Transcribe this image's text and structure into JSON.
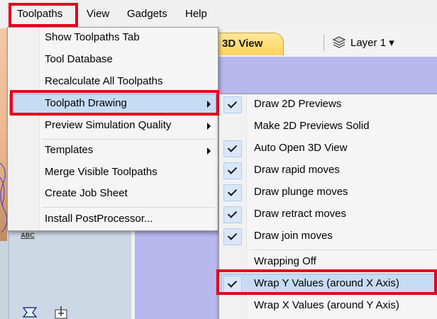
{
  "menubar": {
    "items": [
      {
        "label": "Toolpaths"
      },
      {
        "label": "View"
      },
      {
        "label": "Gadgets"
      },
      {
        "label": "Help"
      }
    ]
  },
  "view_tab": {
    "label": "3D View"
  },
  "toolbar": {
    "layer_label": "Layer 1 ▾"
  },
  "toolpaths_menu": {
    "items": [
      {
        "label": "Show Toolpaths Tab"
      },
      {
        "label": "Tool Database"
      },
      {
        "label": "Recalculate All Toolpaths"
      },
      {
        "label": "Toolpath Drawing",
        "highlighted": true,
        "has_submenu": true
      },
      {
        "label": "Preview Simulation Quality",
        "has_submenu": true
      },
      {
        "label": "Templates",
        "has_submenu": true
      },
      {
        "label": "Merge Visible Toolpaths"
      },
      {
        "label": "Create Job Sheet"
      },
      {
        "label": "Install PostProcessor..."
      }
    ]
  },
  "toolpath_drawing_submenu": {
    "items": [
      {
        "label": "Draw 2D Previews",
        "checked": true
      },
      {
        "label": "Make 2D Previews Solid",
        "checked": false
      },
      {
        "label": "Auto Open 3D View",
        "checked": true
      },
      {
        "label": "Draw rapid moves",
        "checked": true
      },
      {
        "label": "Draw plunge moves",
        "checked": true
      },
      {
        "label": "Draw retract moves",
        "checked": true
      },
      {
        "label": "Draw join moves",
        "checked": true
      },
      {
        "label": "Wrapping Off",
        "checked": false
      },
      {
        "label": "Wrap Y Values (around X Axis)",
        "checked": true,
        "highlighted": true
      },
      {
        "label": "Wrap X Values (around Y Axis)",
        "checked": false
      }
    ]
  },
  "left_strip": {
    "abc_icon_text": "ABC"
  },
  "colors": {
    "annotation_red": "#e4001b",
    "highlight_blue": "#c6dcf4",
    "tab_yellow": "#ffd35b",
    "view_background": "#b8b8ee"
  }
}
